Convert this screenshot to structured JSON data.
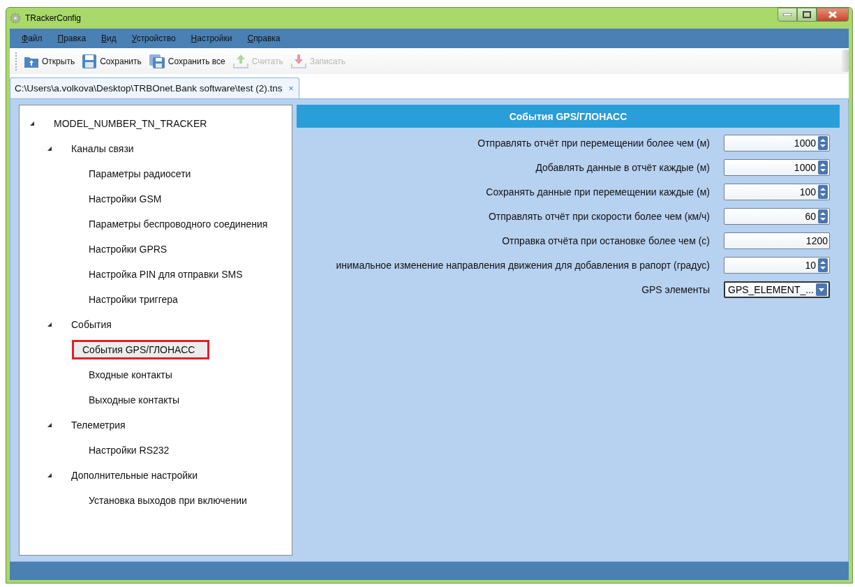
{
  "window": {
    "title": "TRackerConfig"
  },
  "menu": [
    {
      "label": "Файл"
    },
    {
      "label": "Правка"
    },
    {
      "label": "Вид"
    },
    {
      "label": "Устройство"
    },
    {
      "label": "Настройки"
    },
    {
      "label": "Справка"
    }
  ],
  "toolbar": [
    {
      "label": "Открыть",
      "disabled": false
    },
    {
      "label": "Сохранить",
      "disabled": false
    },
    {
      "label": "Сохранить все",
      "disabled": false
    },
    {
      "label": "Считать",
      "disabled": true
    },
    {
      "label": "Записать",
      "disabled": true
    }
  ],
  "tabs": [
    {
      "label": "C:\\Users\\a.volkova\\Desktop\\TRBOnet.Bank software\\test (2).tns",
      "close": "×",
      "selected": true
    }
  ],
  "tree": [
    {
      "label": "MODEL_NUMBER_TN_TRACKER",
      "expanded": true,
      "selected": false,
      "children": [
        {
          "label": "Каналы связи",
          "expanded": true,
          "selected": false,
          "children": [
            {
              "label": "Параметры радиосети",
              "selected": false
            },
            {
              "label": "Настройки GSM",
              "selected": false
            },
            {
              "label": "Параметры беспроводного соединения",
              "selected": false
            },
            {
              "label": "Настройки GPRS",
              "selected": false
            },
            {
              "label": "Настройка PIN для отправки SMS",
              "selected": false
            },
            {
              "label": "Настройки триггера",
              "selected": false
            }
          ]
        },
        {
          "label": "События",
          "expanded": true,
          "selected": false,
          "children": [
            {
              "label": "События GPS/ГЛОНАСС",
              "selected": true
            },
            {
              "label": "Входные контакты",
              "selected": false
            },
            {
              "label": "Выходные контакты",
              "selected": false
            }
          ]
        },
        {
          "label": "Телеметрия",
          "expanded": true,
          "selected": false,
          "children": [
            {
              "label": "Настройки RS232",
              "selected": false
            }
          ]
        },
        {
          "label": "Дополнительные настройки",
          "expanded": true,
          "selected": false,
          "children": [
            {
              "label": "Установка выходов при включении",
              "selected": false
            }
          ]
        }
      ]
    }
  ],
  "panel": {
    "title": "События GPS/ГЛОНАСС",
    "fields": [
      {
        "label": "Отправлять отчёт при перемещении более чем (м)",
        "value": "1000",
        "kind": "spin"
      },
      {
        "label": "Добавлять данные в отчёт каждые (м)",
        "value": "1000",
        "kind": "spin"
      },
      {
        "label": "Сохранять данные при перемещении каждые (м)",
        "value": "100",
        "kind": "spin"
      },
      {
        "label": "Отправлять отчёт при скорости более чем (км/ч)",
        "value": "60",
        "kind": "spin"
      },
      {
        "label": "Отправка отчёта при остановке более чем (с)",
        "value": "1200",
        "kind": "text"
      },
      {
        "label": "инимальное изменение направления движения для добавления в рапорт (градус)",
        "value": "10",
        "kind": "spin"
      },
      {
        "label": "GPS элементы",
        "value": "GPS_ELEMENT_...",
        "kind": "combo"
      }
    ]
  }
}
